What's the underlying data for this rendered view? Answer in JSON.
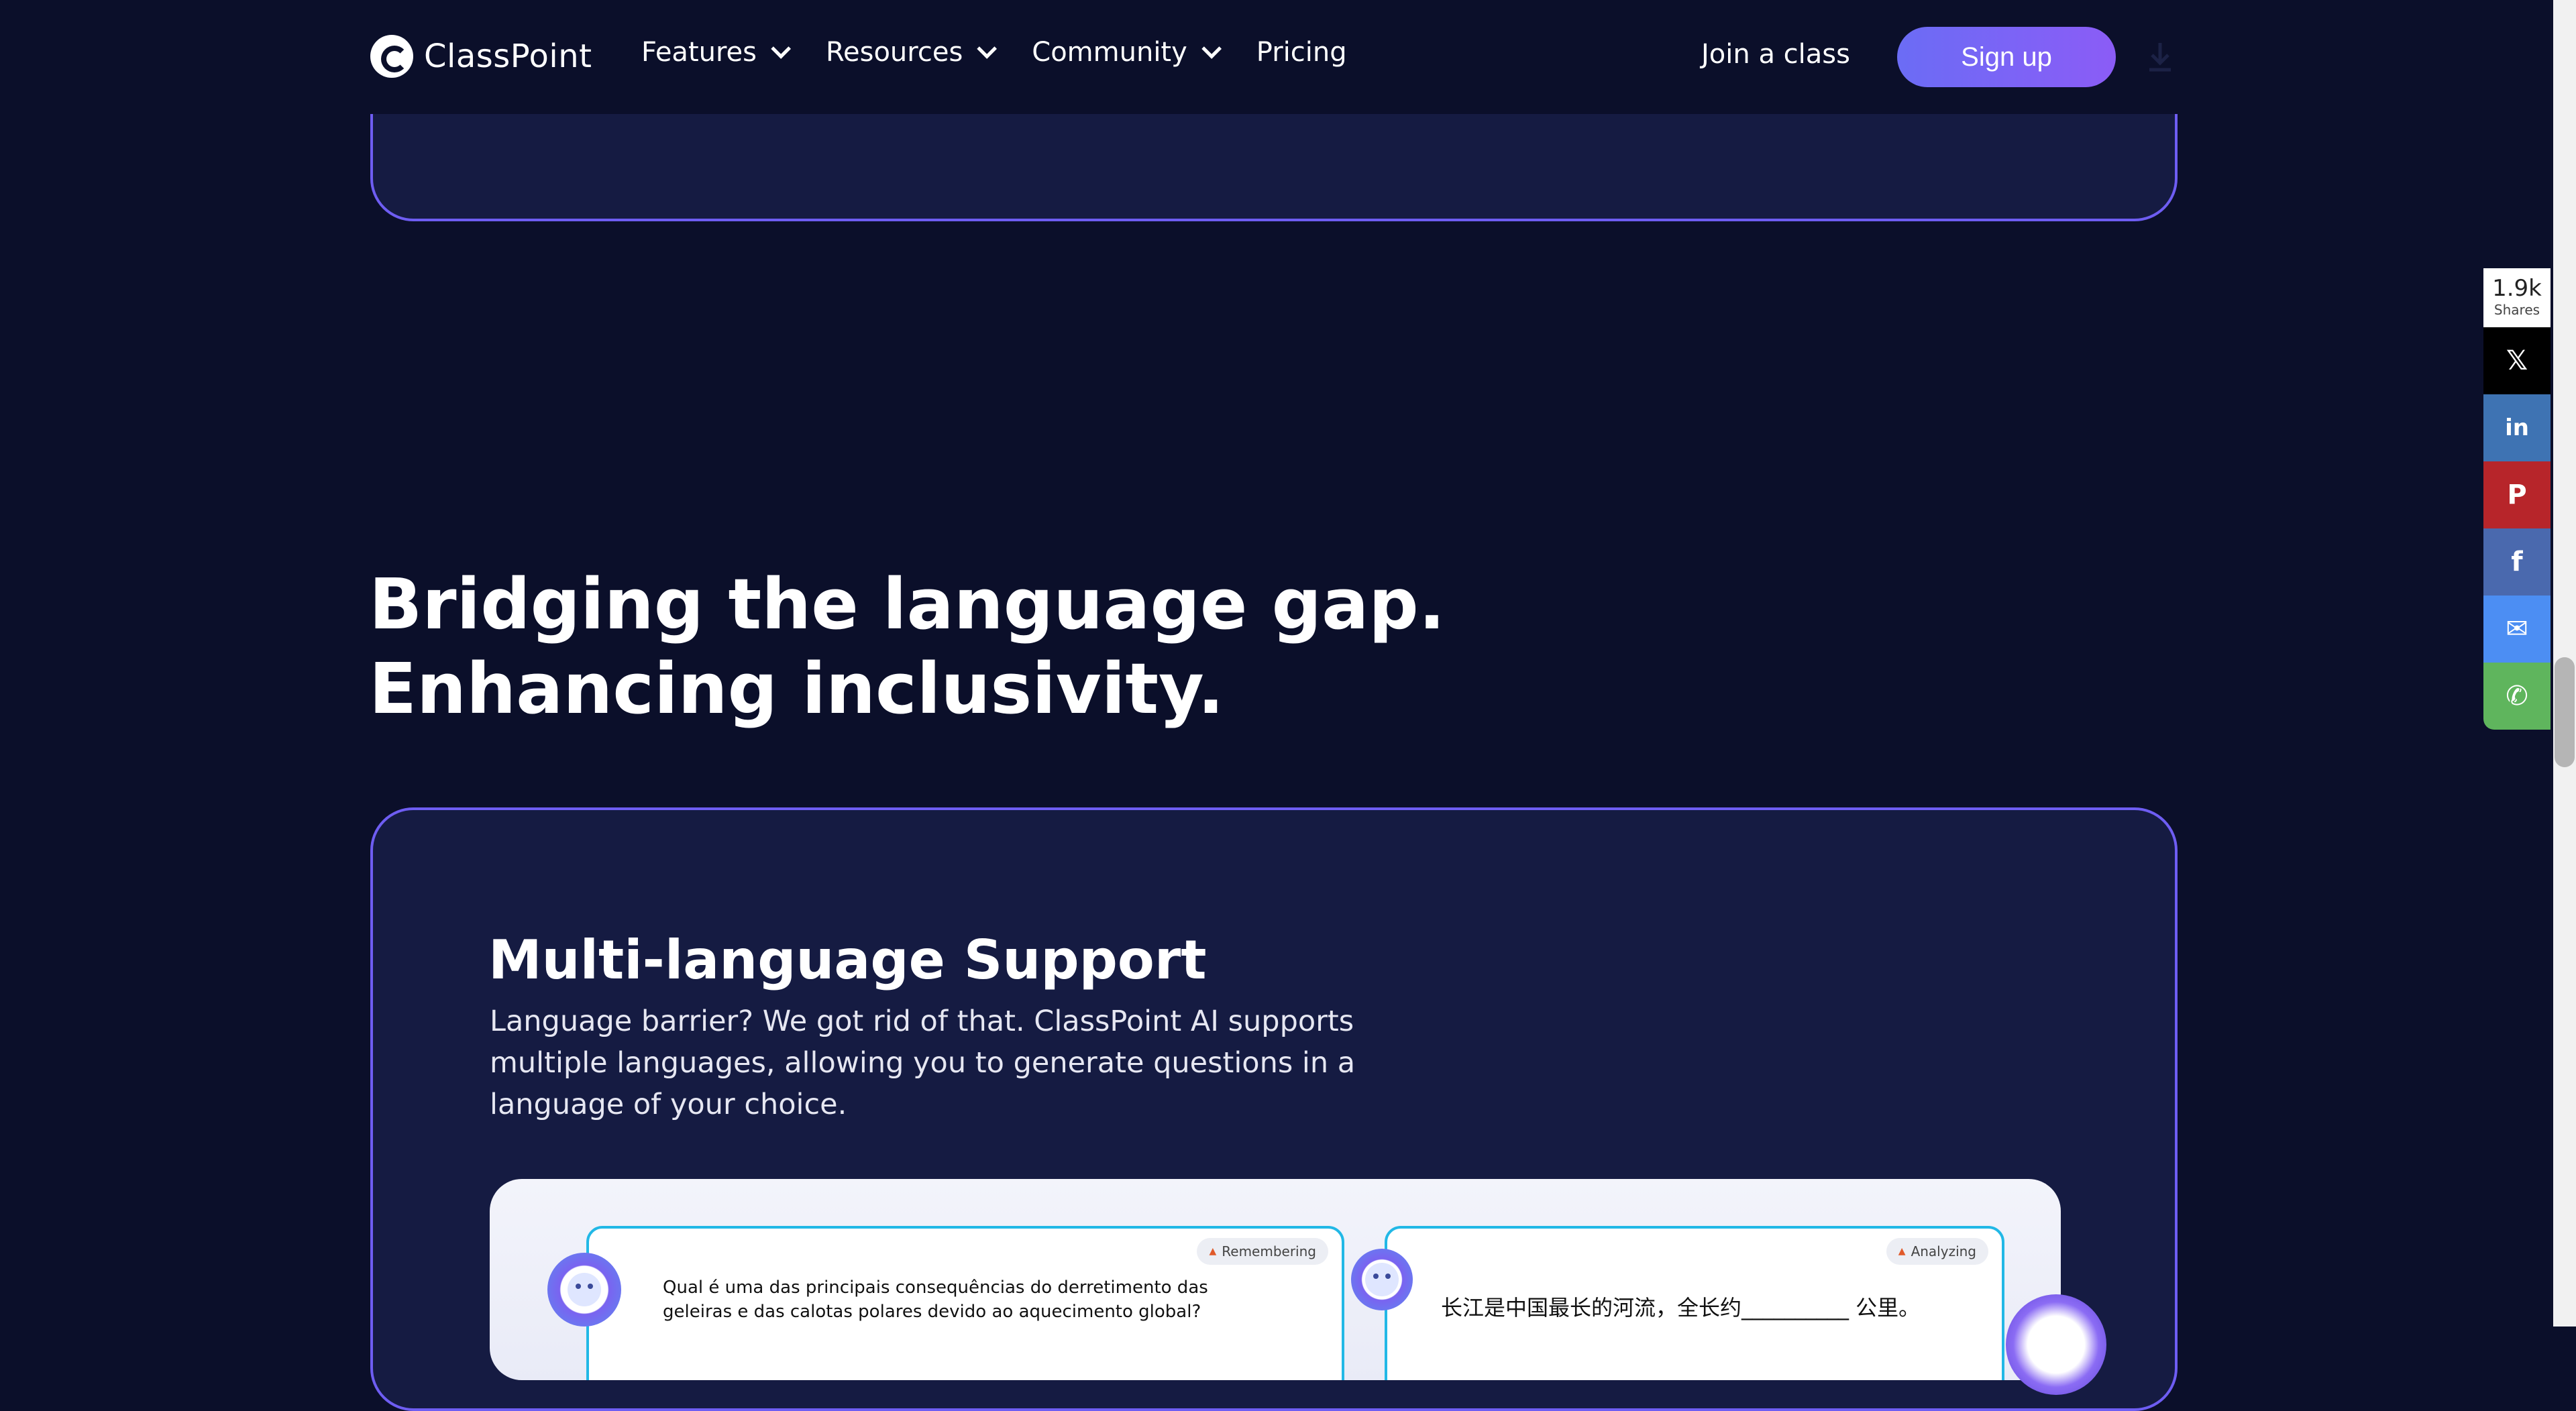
{
  "header": {
    "logo_text": "ClassPoint",
    "nav": [
      {
        "label": "Features",
        "has_dropdown": true
      },
      {
        "label": "Resources",
        "has_dropdown": true
      },
      {
        "label": "Community",
        "has_dropdown": true
      },
      {
        "label": "Pricing",
        "has_dropdown": false
      }
    ],
    "join_label": "Join a class",
    "signup_label": "Sign up"
  },
  "section": {
    "title_line1": "Bridging the language gap.",
    "title_line2": "Enhancing inclusivity."
  },
  "card": {
    "title": "Multi-language Support",
    "description": "Language barrier? We got rid of that. ClassPoint AI supports multiple languages, allowing you to generate questions in a language of your choice."
  },
  "preview": {
    "left_tag": "Remembering",
    "left_question": "Qual é uma das principais consequências do derretimento das geleiras e das calotas polares devido ao aquecimento global?",
    "right_tag": "Analyzing",
    "right_question": "长江是中国最长的河流，全长约__________ 公里。"
  },
  "share_bar": {
    "count": "1.9k",
    "count_label": "Shares",
    "buttons": [
      {
        "name": "x",
        "glyph": "𝕏",
        "color": "#000000"
      },
      {
        "name": "linkedin",
        "glyph": "in",
        "color": "#3e73b3"
      },
      {
        "name": "pinterest",
        "glyph": "P",
        "color": "#b7252a"
      },
      {
        "name": "facebook",
        "glyph": "f",
        "color": "#4a69ae"
      },
      {
        "name": "messenger",
        "glyph": "✉",
        "color": "#4c8ef3"
      },
      {
        "name": "whatsapp",
        "glyph": "✆",
        "color": "#5fb55d"
      }
    ]
  },
  "colors": {
    "background": "#0b0f2a",
    "card_bg": "#151b42",
    "card_border": "#6e5df2",
    "signup_gradient_start": "#6b6cf5",
    "signup_gradient_end": "#8b5cf6"
  }
}
